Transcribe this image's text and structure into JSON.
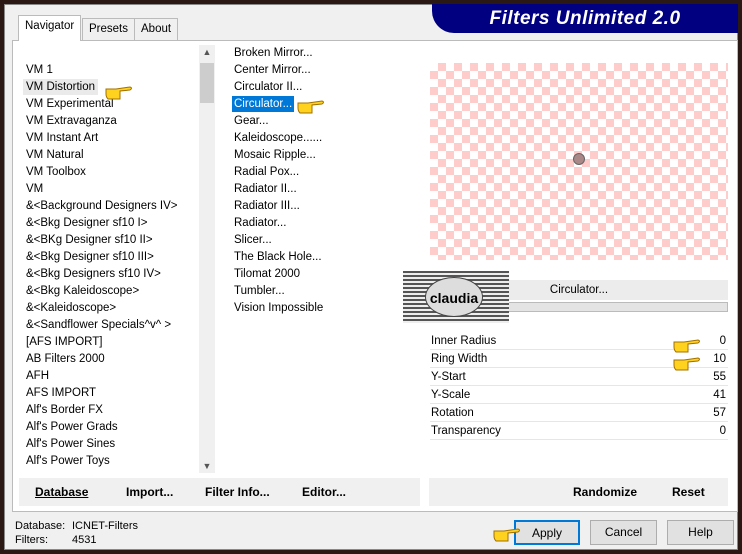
{
  "window": {
    "title": "Filters Unlimited 2.0"
  },
  "tabs": [
    {
      "label": "Navigator",
      "active": true
    },
    {
      "label": "Presets"
    },
    {
      "label": "About"
    }
  ],
  "categories": {
    "selected": "VM Distortion",
    "items": [
      "VM 1",
      "VM Distortion",
      "VM Experimental",
      "VM Extravaganza",
      "VM Instant Art",
      "VM Natural",
      "VM Toolbox",
      "VM",
      "&<Background Designers IV>",
      "&<Bkg Designer sf10 I>",
      "&<BKg Designer sf10 II>",
      "&<Bkg Designer sf10 III>",
      "&<Bkg Designers sf10 IV>",
      "&<Bkg Kaleidoscope>",
      "&<Kaleidoscope>",
      "&<Sandflower Specials^v^ >",
      "[AFS IMPORT]",
      "AB Filters 2000",
      "AFH",
      "AFS IMPORT",
      "Alf's Border FX",
      "Alf's Power Grads",
      "Alf's Power Sines",
      "Alf's Power Toys"
    ]
  },
  "filters": {
    "selected": "Circulator...",
    "items": [
      "Broken Mirror...",
      "Center Mirror...",
      "Circulator II...",
      "Circulator...",
      "Gear...",
      "Kaleidoscope......",
      "Mosaic Ripple...",
      "Radial Pox...",
      "Radiator II...",
      "Radiator III...",
      "Radiator...",
      "Slicer...",
      "The Black Hole...",
      "Tilomat 2000",
      "Tumbler...",
      "Vision Impossible"
    ]
  },
  "preview": {
    "filter_name": "Circulator...",
    "watermark": "claudia"
  },
  "params": [
    {
      "label": "Inner Radius",
      "value": "0"
    },
    {
      "label": "Ring Width",
      "value": "10"
    },
    {
      "label": "Y-Start",
      "value": "55"
    },
    {
      "label": "Y-Scale",
      "value": "41"
    },
    {
      "label": "Rotation",
      "value": "57"
    },
    {
      "label": "Transparency",
      "value": "0"
    }
  ],
  "buttons": {
    "database": "Database",
    "import": "Import...",
    "filter_info": "Filter Info...",
    "editor": "Editor...",
    "randomize": "Randomize",
    "reset": "Reset",
    "apply": "Apply",
    "cancel": "Cancel",
    "help": "Help"
  },
  "status": {
    "database_label": "Database:",
    "database_value": "ICNET-Filters",
    "filters_label": "Filters:",
    "filters_value": "4531"
  },
  "colors": {
    "banner": "#000080",
    "selection": "#0078d7",
    "checker": "#ffcccc"
  }
}
